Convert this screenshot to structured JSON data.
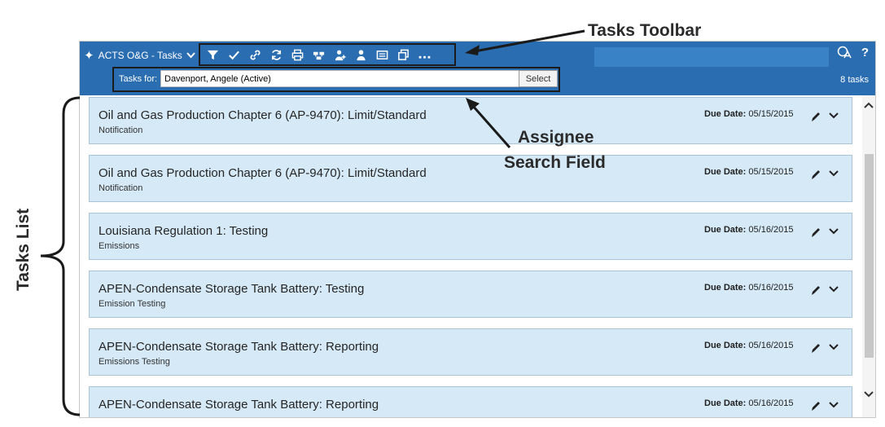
{
  "app": {
    "title": "ACTS O&G - Tasks",
    "toolbar_icons": [
      "filter-icon",
      "check-icon",
      "link-icon",
      "refresh-icon",
      "print-icon",
      "reassign-icon",
      "assign-users-icon",
      "user-icon",
      "notes-icon",
      "copy-icon",
      "more-icon"
    ],
    "header_right": [
      "help-icon"
    ],
    "search_label": "Tasks for:",
    "search_value": "Davenport, Angele (Active)",
    "select_label": "Select",
    "task_count": "8 tasks"
  },
  "tasks": [
    {
      "title": "Oil and Gas Production Chapter 6 (AP-9470): Limit/Standard",
      "subtitle": "Notification",
      "due_label": "Due Date:",
      "due_date": "05/15/2015"
    },
    {
      "title": "Oil and Gas Production Chapter 6 (AP-9470): Limit/Standard",
      "subtitle": "Notification",
      "due_label": "Due Date:",
      "due_date": "05/15/2015"
    },
    {
      "title": "Louisiana Regulation 1: Testing",
      "subtitle": "Emissions",
      "due_label": "Due Date:",
      "due_date": "05/16/2015"
    },
    {
      "title": "APEN-Condensate Storage Tank Battery: Testing",
      "subtitle": "Emission Testing",
      "due_label": "Due Date:",
      "due_date": "05/16/2015"
    },
    {
      "title": "APEN-Condensate Storage Tank Battery: Reporting",
      "subtitle": "Emissions Testing",
      "due_label": "Due Date:",
      "due_date": "05/16/2015"
    },
    {
      "title": "APEN-Condensate Storage Tank Battery: Reporting",
      "subtitle": "",
      "due_label": "Due Date:",
      "due_date": "05/16/2015"
    }
  ],
  "annotations": {
    "toolbar": "Tasks Toolbar",
    "assignee_line1": "Assignee",
    "assignee_line2": "Search Field",
    "tasks_list": "Tasks List"
  },
  "colors": {
    "header_bg": "#2a6db1",
    "card_bg": "#d5e9f6",
    "card_border": "#a9c4d8",
    "annotation": "#2b2b2b"
  }
}
